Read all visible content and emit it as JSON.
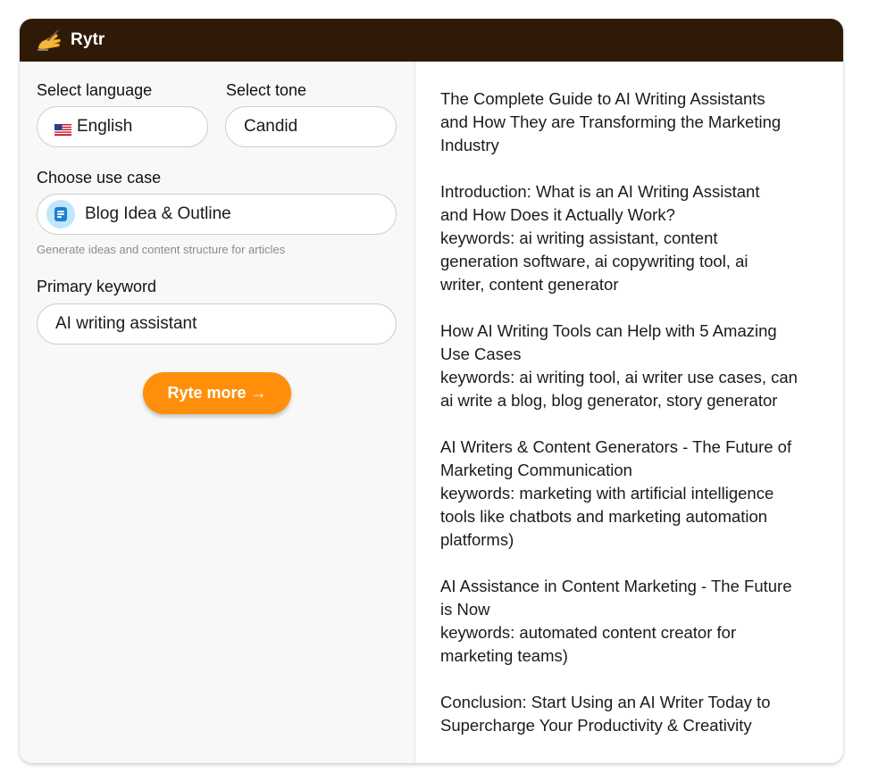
{
  "app": {
    "title": "Rytr",
    "colors": {
      "header_bg": "#2e1a07",
      "accent": "#ff8f0b",
      "left_bg": "#f8f8f8"
    },
    "logo_icon": "writing-hand-icon"
  },
  "form": {
    "language_label": "Select language",
    "language_value": "English",
    "language_flag_icon": "us-flag-icon",
    "tone_label": "Select tone",
    "tone_value": "Candid",
    "usecase_label": "Choose use case",
    "usecase_value": "Blog Idea & Outline",
    "usecase_icon": "document-icon",
    "usecase_hint": "Generate ideas and content structure for articles",
    "keyword_label": "Primary keyword",
    "keyword_value": "AI writing assistant",
    "submit_label": "Ryte more →"
  },
  "output": {
    "blocks": [
      {
        "lines": [
          "The Complete Guide to AI Writing Assistants",
          "and How They are Transforming the Marketing",
          "Industry"
        ]
      },
      {
        "lines": [
          "Introduction: What is an AI Writing Assistant",
          "and How Does it Actually Work?",
          "keywords: ai writing assistant, content",
          "generation software, ai copywriting tool, ai",
          "writer, content generator"
        ]
      },
      {
        "lines": [
          "How AI Writing Tools can Help with 5 Amazing",
          "Use Cases",
          "keywords: ai writing tool, ai writer use cases, can",
          "ai write a blog, blog generator, story generator"
        ]
      },
      {
        "lines": [
          "AI Writers & Content Generators - The Future of",
          "Marketing Communication",
          "keywords:  marketing with artificial intelligence",
          "tools like chatbots and marketing automation",
          "platforms)"
        ]
      },
      {
        "lines": [
          "AI Assistance in Content Marketing - The Future",
          "is Now",
          "keywords:  automated content creator for",
          "marketing teams)"
        ]
      },
      {
        "lines": [
          "Conclusion: Start Using an AI Writer Today to",
          "Supercharge Your Productivity & Creativity"
        ]
      }
    ]
  }
}
